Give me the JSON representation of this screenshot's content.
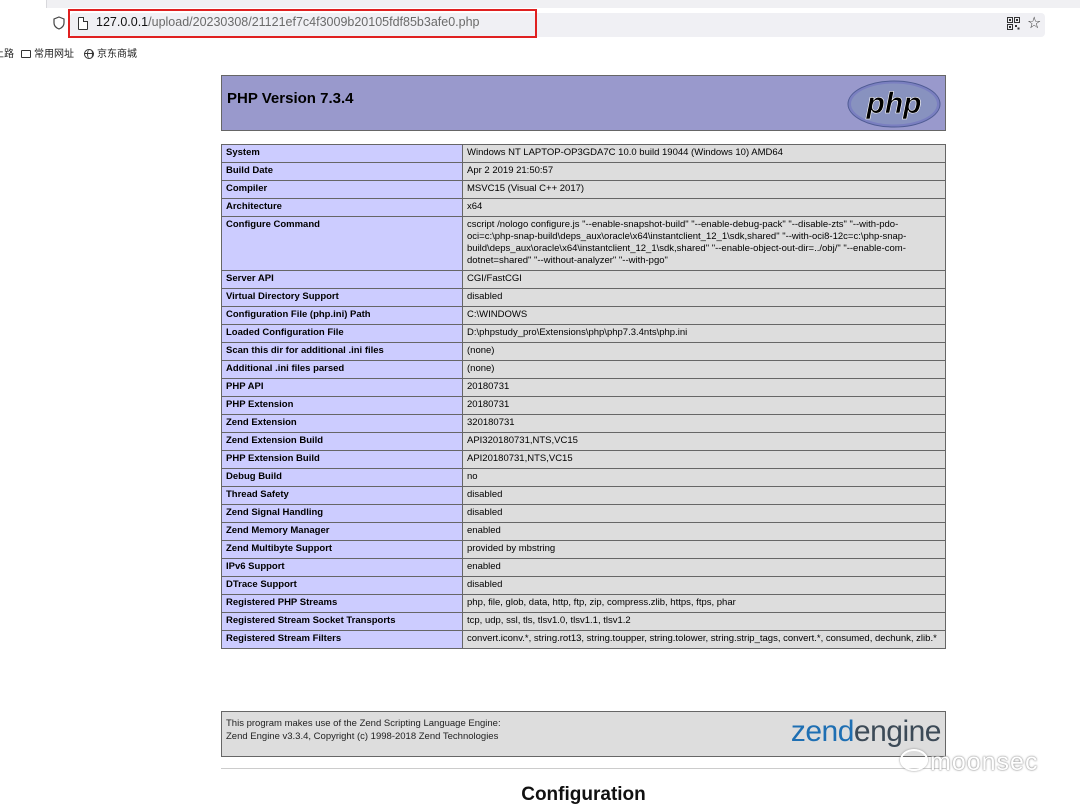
{
  "browser": {
    "url_host": "127.0.0.1",
    "url_path": "/upload/20230308/21121ef7c4f3009b20105fdf85b3afe0.php",
    "bookmarks": [
      {
        "label": "上路",
        "icon": "none"
      },
      {
        "label": "常用网址",
        "icon": "folder-icon"
      },
      {
        "label": "京东商城",
        "icon": "globe-icon"
      }
    ],
    "highlight_color": "#e02020"
  },
  "phpinfo": {
    "version_title": "PHP Version 7.3.4",
    "logo_text": "php",
    "header_color": "#9999cc",
    "key_color": "#ccccff",
    "value_color": "#dddddd",
    "rows": [
      {
        "key": "System",
        "value": "Windows NT LAPTOP-OP3GDA7C 10.0 build 19044 (Windows 10) AMD64"
      },
      {
        "key": "Build Date",
        "value": "Apr 2 2019 21:50:57"
      },
      {
        "key": "Compiler",
        "value": "MSVC15 (Visual C++ 2017)"
      },
      {
        "key": "Architecture",
        "value": "x64"
      },
      {
        "key": "Configure Command",
        "value": "cscript /nologo configure.js \"--enable-snapshot-build\" \"--enable-debug-pack\" \"--disable-zts\" \"--with-pdo-oci=c:\\php-snap-build\\deps_aux\\oracle\\x64\\instantclient_12_1\\sdk,shared\" \"--with-oci8-12c=c:\\php-snap-build\\deps_aux\\oracle\\x64\\instantclient_12_1\\sdk,shared\" \"--enable-object-out-dir=../obj/\" \"--enable-com-dotnet=shared\" \"--without-analyzer\" \"--with-pgo\""
      },
      {
        "key": "Server API",
        "value": "CGI/FastCGI"
      },
      {
        "key": "Virtual Directory Support",
        "value": "disabled"
      },
      {
        "key": "Configuration File (php.ini) Path",
        "value": "C:\\WINDOWS"
      },
      {
        "key": "Loaded Configuration File",
        "value": "D:\\phpstudy_pro\\Extensions\\php\\php7.3.4nts\\php.ini"
      },
      {
        "key": "Scan this dir for additional .ini files",
        "value": "(none)"
      },
      {
        "key": "Additional .ini files parsed",
        "value": "(none)"
      },
      {
        "key": "PHP API",
        "value": "20180731"
      },
      {
        "key": "PHP Extension",
        "value": "20180731"
      },
      {
        "key": "Zend Extension",
        "value": "320180731"
      },
      {
        "key": "Zend Extension Build",
        "value": "API320180731,NTS,VC15"
      },
      {
        "key": "PHP Extension Build",
        "value": "API20180731,NTS,VC15"
      },
      {
        "key": "Debug Build",
        "value": "no"
      },
      {
        "key": "Thread Safety",
        "value": "disabled"
      },
      {
        "key": "Zend Signal Handling",
        "value": "disabled"
      },
      {
        "key": "Zend Memory Manager",
        "value": "enabled"
      },
      {
        "key": "Zend Multibyte Support",
        "value": "provided by mbstring"
      },
      {
        "key": "IPv6 Support",
        "value": "enabled"
      },
      {
        "key": "DTrace Support",
        "value": "disabled"
      },
      {
        "key": "Registered PHP Streams",
        "value": "php, file, glob, data, http, ftp, zip, compress.zlib, https, ftps, phar"
      },
      {
        "key": "Registered Stream Socket Transports",
        "value": "tcp, udp, ssl, tls, tlsv1.0, tlsv1.1, tlsv1.2"
      },
      {
        "key": "Registered Stream Filters",
        "value": "convert.iconv.*, string.rot13, string.toupper, string.tolower, string.strip_tags, convert.*, consumed, dechunk, zlib.*"
      }
    ],
    "zend": {
      "line1": "This program makes use of the Zend Scripting Language Engine:",
      "line2": "Zend Engine v3.3.4, Copyright (c) 1998-2018 Zend Technologies",
      "logo_zend": "zend",
      "logo_engine": "engine"
    },
    "section_title": "Configuration"
  },
  "watermark": "moonsec"
}
